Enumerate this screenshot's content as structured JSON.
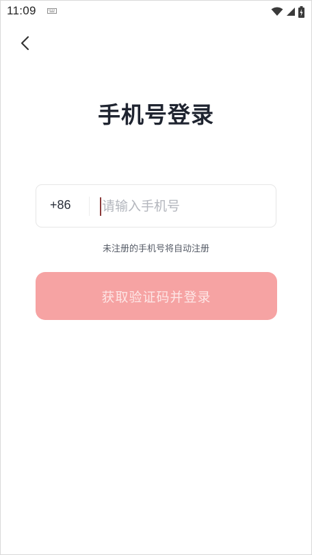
{
  "status_bar": {
    "time": "11:09",
    "icons": [
      "keyboard-icon",
      "wifi-icon",
      "signal-icon",
      "battery-icon"
    ]
  },
  "header": {
    "back_icon": "chevron-left-icon"
  },
  "main": {
    "title": "手机号登录",
    "country_code": "+86",
    "phone_input": {
      "value": "",
      "placeholder": "请输入手机号"
    },
    "hint": "未注册的手机号将自动注册",
    "login_button_label": "获取验证码并登录"
  },
  "colors": {
    "title": "#1f2430",
    "button_bg": "#f6a3a3",
    "button_text": "#fde6e6",
    "caret": "#8b3a3a"
  }
}
